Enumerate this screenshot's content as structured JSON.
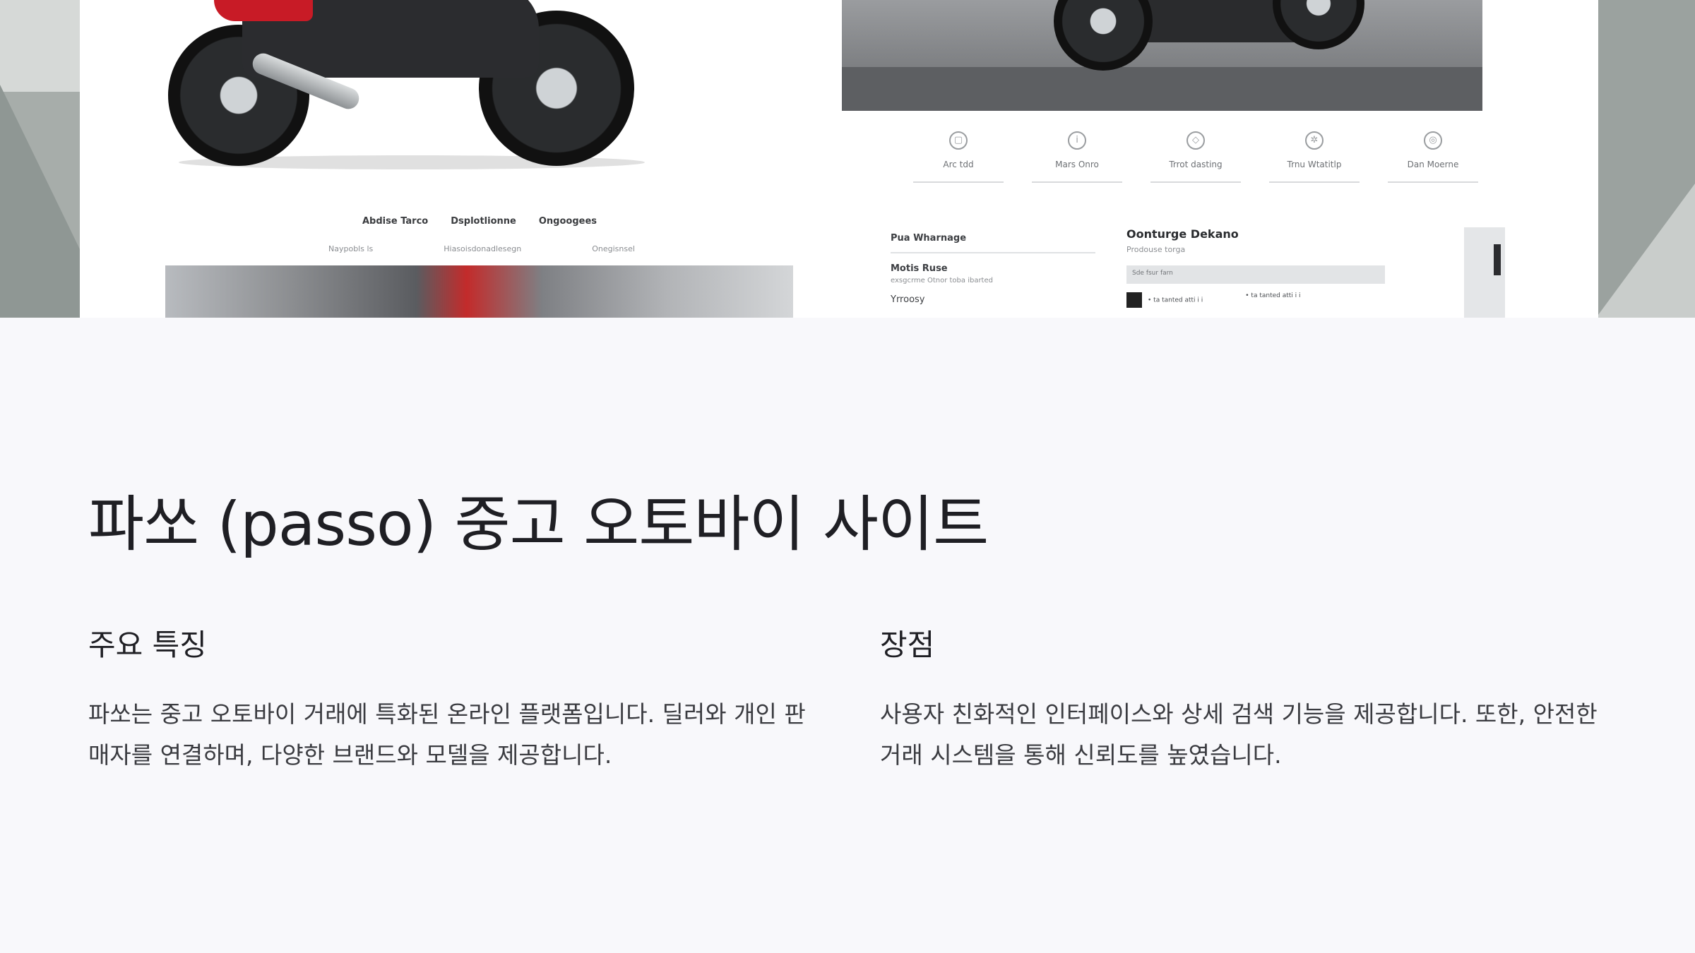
{
  "mockup": {
    "nav": [
      "Abdise Tarco",
      "Dsplotlionne",
      "Ongoogees"
    ],
    "subnav": [
      "Naypobls ls",
      "Hiasoisdonadlesegn",
      "Onegisnsel"
    ],
    "features": [
      {
        "icon": "box-icon",
        "glyph": "▢",
        "label": "Arc tdd"
      },
      {
        "icon": "info-icon",
        "glyph": "i",
        "label": "Mars Onro"
      },
      {
        "icon": "tag-icon",
        "glyph": "◇",
        "label": "Trrot dasting"
      },
      {
        "icon": "gear-icon",
        "glyph": "✲",
        "label": "Trnu Wtatitlp"
      },
      {
        "icon": "target-icon",
        "glyph": "◎",
        "label": "Dan Moerne"
      }
    ],
    "info_left": {
      "heading": "Pua Wharnage",
      "sub_heading": "Motis Ruse",
      "sub_text": "exsgcrme Otnor toba ibarted",
      "third": "Yrroosy"
    },
    "info_right": {
      "heading": "Oonturge Dekano",
      "sub": "Prodouse torga",
      "bar_text": "Sde fsur farn",
      "row_items": [
        "• ta tanted   atti i i",
        "• ta tanted   atti i i"
      ]
    }
  },
  "page": {
    "title": "파쏘 (passo) 중고 오토바이 사이트",
    "left": {
      "heading": "주요 특징",
      "body": "파쏘는 중고 오토바이 거래에 특화된 온라인 플랫폼입니다. 딜러와 개인 판매자를 연결하며, 다양한 브랜드와 모델을 제공합니다."
    },
    "right": {
      "heading": "장점",
      "body": "사용자 친화적인 인터페이스와 상세 검색 기능을 제공합니다. 또한, 안전한 거래 시스템을 통해 신뢰도를 높였습니다."
    }
  }
}
